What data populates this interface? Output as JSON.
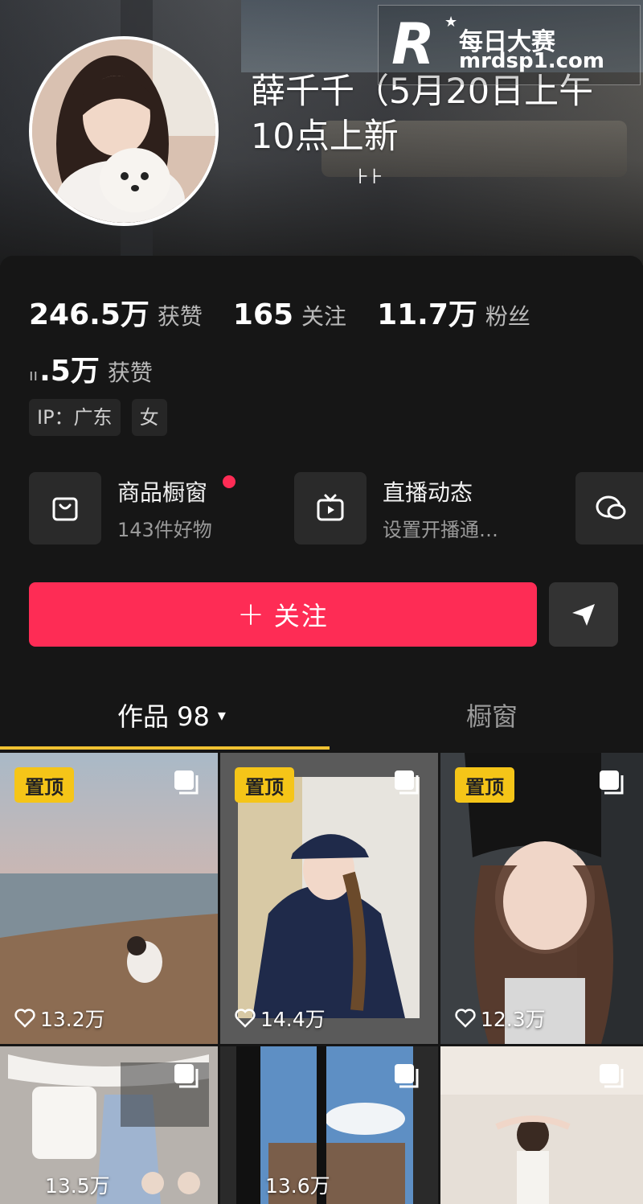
{
  "watermark": {
    "brand": "每日大赛",
    "url": "mrdsp1.com",
    "letter": "R"
  },
  "profile": {
    "name": "薛千千（5月20日上午10点上新",
    "name_truncation": "⊦⊦"
  },
  "stats": [
    {
      "value": "246.5万",
      "label": "获赞"
    },
    {
      "value": "165",
      "label": "关注"
    },
    {
      "value": "11.7万",
      "label": "粉丝"
    }
  ],
  "stats_extra": {
    "prefix": "ıı",
    "value": ".5万",
    "label": "获赞"
  },
  "tags": [
    "IP：广东",
    "女"
  ],
  "features": [
    {
      "title": "商品橱窗",
      "subtitle": "143件好物",
      "icon": "shopping-bag-icon",
      "badge": true
    },
    {
      "title": "直播动态",
      "subtitle": "设置开播通…",
      "icon": "tv-icon",
      "badge": false
    },
    {
      "title": "",
      "subtitle": "",
      "icon": "chat-bubbles-icon",
      "badge": false
    }
  ],
  "actions": {
    "follow_plus": "+",
    "follow_label": "关注",
    "share_icon": "send-icon"
  },
  "tabs": {
    "works_label": "作品 98",
    "works_caret": "▾",
    "shop_label": "橱窗"
  },
  "videos": [
    {
      "pinned": true,
      "pin_label": "置顶",
      "likes": "13.2万",
      "scene": "beach"
    },
    {
      "pinned": true,
      "pin_label": "置顶",
      "likes": "14.4万",
      "scene": "cap-braid"
    },
    {
      "pinned": true,
      "pin_label": "置顶",
      "likes": "12.3万",
      "scene": "beanie-car"
    },
    {
      "pinned": false,
      "pin_label": "",
      "likes": "13.5万",
      "scene": "outfit-flatlay"
    },
    {
      "pinned": false,
      "pin_label": "",
      "likes": "13.6万",
      "scene": "window-sky"
    },
    {
      "pinned": false,
      "pin_label": "",
      "likes": "",
      "scene": "dancer-room"
    }
  ],
  "colors": {
    "accent": "#fe2c55",
    "pin": "#f5c518",
    "tab_underline": "#f1c232",
    "bg": "#161616"
  }
}
